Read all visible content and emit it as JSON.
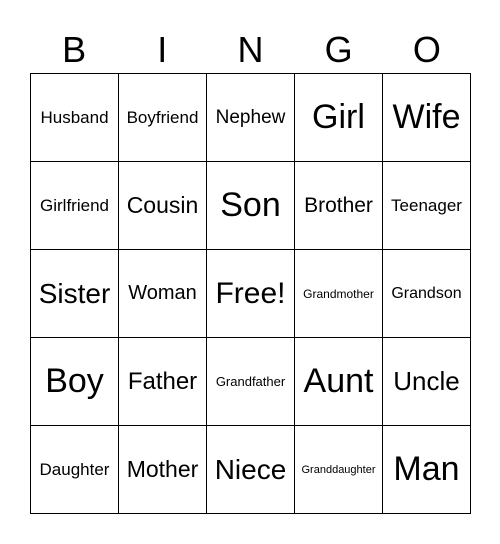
{
  "header": [
    "B",
    "I",
    "N",
    "G",
    "O"
  ],
  "cells": [
    [
      "Husband",
      "Boyfriend",
      "Nephew",
      "Girl",
      "Wife"
    ],
    [
      "Girlfriend",
      "Cousin",
      "Son",
      "Brother",
      "Teenager"
    ],
    [
      "Sister",
      "Woman",
      "Free!",
      "Grandmother",
      "Grandson"
    ],
    [
      "Boy",
      "Father",
      "Grandfather",
      "Aunt",
      "Uncle"
    ],
    [
      "Daughter",
      "Mother",
      "Niece",
      "Granddaughter",
      "Man"
    ]
  ]
}
